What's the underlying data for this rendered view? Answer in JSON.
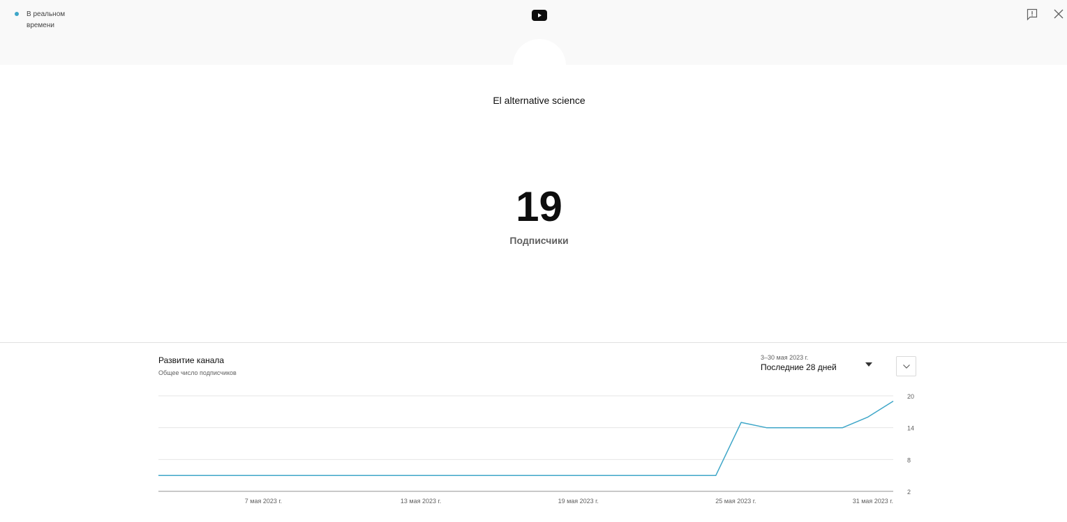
{
  "live": {
    "label": "В реальном времени"
  },
  "channel": {
    "name": "El alternative science"
  },
  "stats": {
    "count": "19",
    "label": "Подписчики"
  },
  "section": {
    "title": "Развитие канала",
    "subtitle": "Общее число подписчиков",
    "period_range": "3–30 мая 2023 г.",
    "period_label": "Последние 28 дней"
  },
  "colors": {
    "accent": "#3ea6c8",
    "grid": "#e5e5e5",
    "axis": "#909090"
  },
  "icons": {
    "logo": "youtube-logo-icon",
    "feedback": "feedback-icon",
    "close": "close-icon",
    "dropdown": "dropdown-arrow-icon",
    "expand": "chevron-down-icon"
  },
  "chart_data": {
    "type": "line",
    "x": [
      "2023-05-03",
      "2023-05-04",
      "2023-05-05",
      "2023-05-06",
      "2023-05-07",
      "2023-05-08",
      "2023-05-09",
      "2023-05-10",
      "2023-05-11",
      "2023-05-12",
      "2023-05-13",
      "2023-05-14",
      "2023-05-15",
      "2023-05-16",
      "2023-05-17",
      "2023-05-18",
      "2023-05-19",
      "2023-05-20",
      "2023-05-21",
      "2023-05-22",
      "2023-05-23",
      "2023-05-24",
      "2023-05-25",
      "2023-05-26",
      "2023-05-27",
      "2023-05-28",
      "2023-05-29",
      "2023-05-30",
      "2023-05-31"
    ],
    "series": [
      {
        "values": [
          5,
          5,
          5,
          5,
          5,
          5,
          5,
          5,
          5,
          5,
          5,
          5,
          5,
          5,
          5,
          5,
          5,
          5,
          5,
          5,
          5,
          5,
          5,
          15,
          14,
          14,
          14,
          14,
          16,
          19
        ]
      }
    ],
    "xtick_labels": [
      "7 мая 2023 г.",
      "13 мая 2023 г.",
      "19 мая 2023 г.",
      "25 мая 2023 г.",
      "31 мая 2023 г."
    ],
    "xtick_dates": [
      "2023-05-07",
      "2023-05-13",
      "2023-05-19",
      "2023-05-25",
      "2023-05-31"
    ],
    "yticks": [
      2,
      8,
      14,
      20
    ],
    "ylim": [
      2,
      20
    ],
    "grid": true,
    "legend": "none"
  }
}
